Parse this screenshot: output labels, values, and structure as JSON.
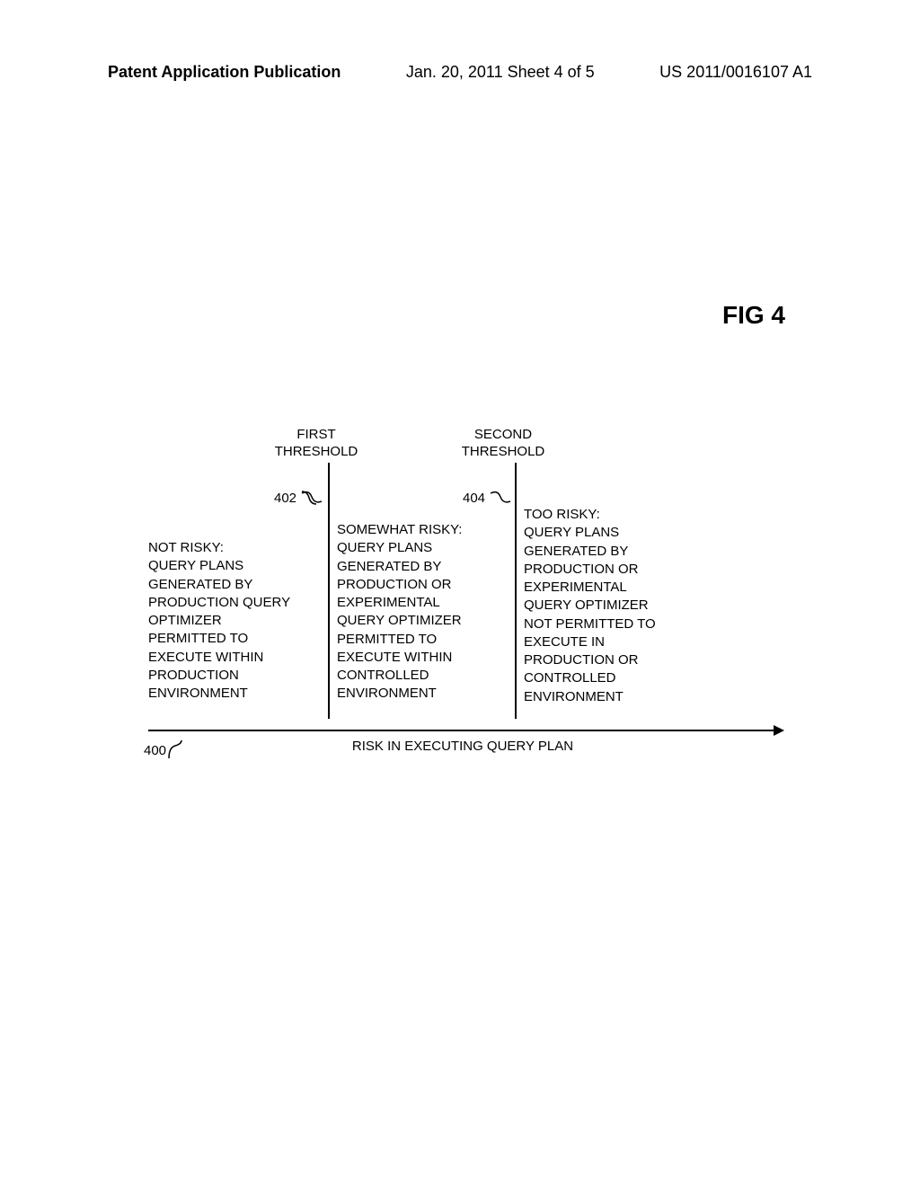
{
  "header": {
    "left": "Patent Application Publication",
    "center": "Jan. 20, 2011  Sheet 4 of 5",
    "right": "US 2011/0016107 A1"
  },
  "figure_title": "FIG 4",
  "thresholds": {
    "first": {
      "label": "FIRST\nTHRESHOLD",
      "ref": "402"
    },
    "second": {
      "label": "SECOND\nTHRESHOLD",
      "ref": "404"
    }
  },
  "columns": {
    "col1": "NOT RISKY:\nQUERY PLANS\nGENERATED BY\nPRODUCTION QUERY\nOPTIMIZER\nPERMITTED TO\nEXECUTE WITHIN\nPRODUCTION\nENVIRONMENT",
    "col2": "SOMEWHAT RISKY:\nQUERY PLANS\nGENERATED BY\nPRODUCTION OR\nEXPERIMENTAL\nQUERY OPTIMIZER\nPERMITTED TO\nEXECUTE WITHIN\nCONTROLLED\nENVIRONMENT",
    "col3": "TOO RISKY:\nQUERY PLANS\nGENERATED BY\nPRODUCTION OR\nEXPERIMENTAL\nQUERY OPTIMIZER\nNOT PERMITTED TO\nEXECUTE IN\nPRODUCTION OR\nCONTROLLED\nENVIRONMENT"
  },
  "axis": {
    "label": "RISK IN EXECUTING QUERY PLAN",
    "ref": "400"
  },
  "chart_data": {
    "type": "table",
    "title": "FIG 4",
    "axis_label": "RISK IN EXECUTING QUERY PLAN",
    "axis_ref": "400",
    "thresholds": [
      {
        "name": "FIRST THRESHOLD",
        "ref": "402"
      },
      {
        "name": "SECOND THRESHOLD",
        "ref": "404"
      }
    ],
    "regions": [
      {
        "range": "below first threshold",
        "label": "NOT RISKY",
        "description": "QUERY PLANS GENERATED BY PRODUCTION QUERY OPTIMIZER PERMITTED TO EXECUTE WITHIN PRODUCTION ENVIRONMENT"
      },
      {
        "range": "between first and second threshold",
        "label": "SOMEWHAT RISKY",
        "description": "QUERY PLANS GENERATED BY PRODUCTION OR EXPERIMENTAL QUERY OPTIMIZER PERMITTED TO EXECUTE WITHIN CONTROLLED ENVIRONMENT"
      },
      {
        "range": "above second threshold",
        "label": "TOO RISKY",
        "description": "QUERY PLANS GENERATED BY PRODUCTION OR EXPERIMENTAL QUERY OPTIMIZER NOT PERMITTED TO EXECUTE IN PRODUCTION OR CONTROLLED ENVIRONMENT"
      }
    ]
  }
}
